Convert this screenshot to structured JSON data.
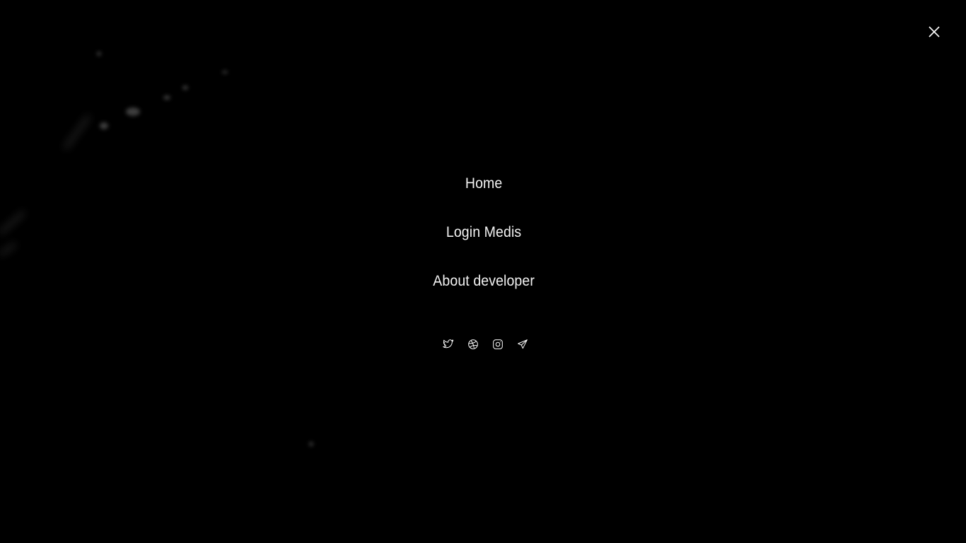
{
  "overlay": {
    "close_icon": "close-icon"
  },
  "nav": {
    "items": [
      {
        "label": "Home"
      },
      {
        "label": "Login Medis"
      },
      {
        "label": "About developer"
      }
    ]
  },
  "social": {
    "icons": [
      "twitter-icon",
      "dribbble-icon",
      "instagram-icon",
      "telegram-icon"
    ]
  },
  "colors": {
    "background": "#000000",
    "text": "#f2f2f2"
  }
}
